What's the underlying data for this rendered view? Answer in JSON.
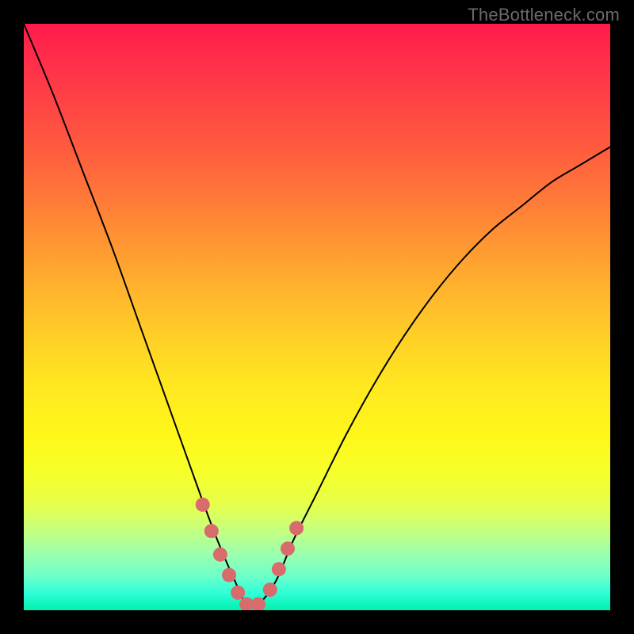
{
  "watermark": "TheBottleneck.com",
  "chart_data": {
    "type": "line",
    "title": "",
    "xlabel": "",
    "ylabel": "",
    "x_range": [
      0,
      100
    ],
    "y_range": [
      0,
      100
    ],
    "description": "V-shaped bottleneck curve on rainbow gradient background (red top to green bottom). Minimum near x≈38. Values are percentage height from bottom (0=bottom green, 100=top red).",
    "series": [
      {
        "name": "curve",
        "x": [
          0,
          5,
          10,
          15,
          20,
          25,
          30,
          33,
          36,
          38,
          40,
          43,
          46,
          50,
          55,
          60,
          65,
          70,
          75,
          80,
          85,
          90,
          95,
          100
        ],
        "y": [
          100,
          88,
          75,
          62,
          48,
          34,
          20,
          12,
          5,
          1,
          1,
          5,
          12,
          20,
          30,
          39,
          47,
          54,
          60,
          65,
          69,
          73,
          76,
          79
        ]
      }
    ],
    "markers": {
      "name": "highlight-dots",
      "color": "#d86b6b",
      "x": [
        30.5,
        32.0,
        33.5,
        35.0,
        36.5,
        38.0,
        40.0,
        42.0,
        43.5,
        45.0,
        46.5
      ],
      "y": [
        18.0,
        13.5,
        9.5,
        6.0,
        3.0,
        1.0,
        1.0,
        3.5,
        7.0,
        10.5,
        14.0
      ]
    }
  }
}
